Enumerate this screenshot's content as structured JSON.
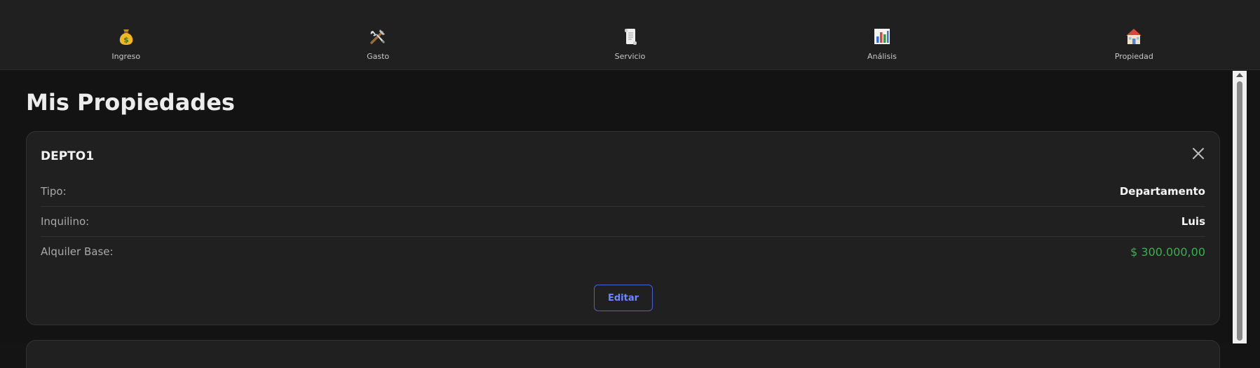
{
  "nav": {
    "items": [
      {
        "label": "Ingreso",
        "icon": "money-bag-icon"
      },
      {
        "label": "Gasto",
        "icon": "tools-icon"
      },
      {
        "label": "Servicio",
        "icon": "scroll-icon"
      },
      {
        "label": "Análisis",
        "icon": "bar-chart-icon"
      },
      {
        "label": "Propiedad",
        "icon": "house-icon"
      }
    ]
  },
  "main": {
    "title": "Mis Propiedades",
    "property": {
      "name": "DEPTO1",
      "rows": [
        {
          "label": "Tipo:",
          "value": "Departamento"
        },
        {
          "label": "Inquilino:",
          "value": "Luis"
        },
        {
          "label": "Alquiler Base:",
          "value": "$ 300.000,00"
        }
      ],
      "edit_label": "Editar"
    }
  },
  "colors": {
    "background": "#141414",
    "card": "#202020",
    "accent": "#4a5fdc",
    "money": "#36b24a"
  }
}
